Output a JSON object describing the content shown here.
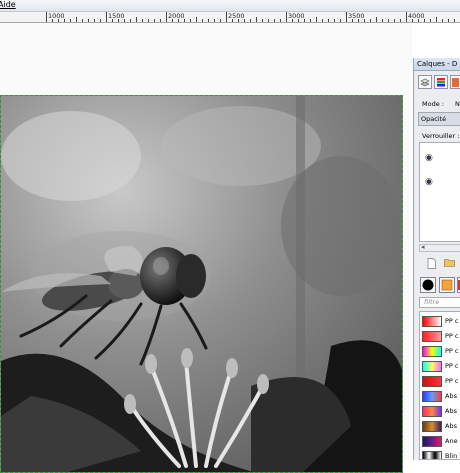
{
  "menubar": {
    "help_label": "Aide"
  },
  "ruler": {
    "labels": [
      "1000",
      "1500",
      "2000",
      "2500",
      "3000",
      "3500",
      "4000"
    ]
  },
  "canvas": {
    "selection_color": "#2e9a2e"
  },
  "layers_dock": {
    "title": "Calques - D",
    "mode_label": "Mode :",
    "mode_value": "N",
    "opacity_label": "Opacité",
    "lock_label": "Verrouiller :",
    "filter_placeholder": "filtre",
    "icons": [
      "layers-tab-icon",
      "channels-tab-icon",
      "paths-tab-icon",
      "eye-icon",
      "new-layer-icon",
      "new-group-icon"
    ]
  },
  "gradients": [
    {
      "name": "PP c",
      "colors": [
        "#ff0000",
        "#ffffff"
      ]
    },
    {
      "name": "PP c",
      "colors": [
        "#ff2020",
        "#ff9a9a"
      ]
    },
    {
      "name": "PP c",
      "colors": [
        "#ff00ff",
        "#ffff00",
        "#00ffff"
      ]
    },
    {
      "name": "PP c",
      "colors": [
        "#00ffff",
        "#ffff66",
        "#ff66ff"
      ]
    },
    {
      "name": "PP c",
      "colors": [
        "#cc1111",
        "#ff3333"
      ]
    },
    {
      "name": "Abs",
      "colors": [
        "#2a3cff",
        "#5fa0ff",
        "#ff3a3a"
      ]
    },
    {
      "name": "Abs",
      "colors": [
        "#ff2b6b",
        "#ff8a3a",
        "#7a2bff"
      ]
    },
    {
      "name": "Abs",
      "colors": [
        "#6a3a1a",
        "#d88f2a",
        "#3a1a6a"
      ]
    },
    {
      "name": "Ane",
      "colors": [
        "#1a1a5a",
        "#6a1a8a",
        "#e01a5a"
      ]
    },
    {
      "name": "Blin",
      "colors": [
        "#000000",
        "#ffffff",
        "#000000",
        "#ffffff"
      ]
    }
  ]
}
